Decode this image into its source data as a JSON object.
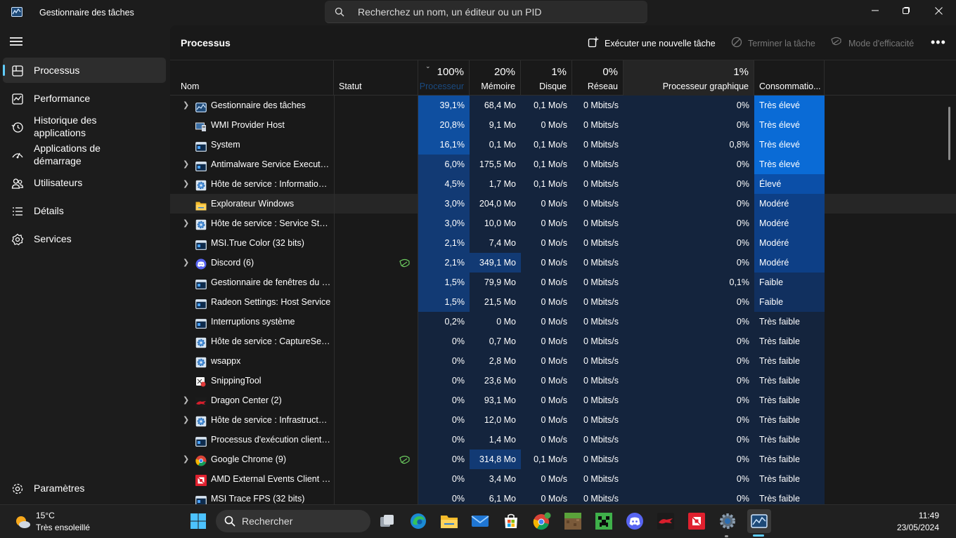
{
  "titlebar": {
    "title": "Gestionnaire des tâches",
    "search_placeholder": "Recherchez un nom, un éditeur ou un PID"
  },
  "sidebar": {
    "items": [
      {
        "label": "Processus",
        "icon": "processes-icon",
        "active": true
      },
      {
        "label": "Performance",
        "icon": "performance-icon"
      },
      {
        "label": "Historique des applications",
        "icon": "history-icon"
      },
      {
        "label": "Applications de démarrage",
        "icon": "startup-icon"
      },
      {
        "label": "Utilisateurs",
        "icon": "users-icon"
      },
      {
        "label": "Détails",
        "icon": "details-icon"
      },
      {
        "label": "Services",
        "icon": "services-icon"
      }
    ],
    "settings_label": "Paramètres"
  },
  "commandbar": {
    "title": "Processus",
    "run_task": "Exécuter une nouvelle tâche",
    "end_task": "Terminer la tâche",
    "efficiency": "Mode d'efficacité"
  },
  "table": {
    "headers": {
      "name": "Nom",
      "status": "Statut",
      "cpu_pct": "100%",
      "cpu": "Processeur",
      "mem_pct": "20%",
      "mem": "Mémoire",
      "disk_pct": "1%",
      "disk": "Disque",
      "net_pct": "0%",
      "net": "Réseau",
      "gpu_pct": "1%",
      "gpu": "Processeur graphique",
      "power": "Consommatio..."
    },
    "rows": [
      {
        "name": "Gestionnaire des tâches",
        "expand": true,
        "icon": "taskmgr",
        "cpu": "39,1%",
        "mem": "68,4 Mo",
        "disk": "0,1 Mo/s",
        "net": "0 Mbits/s",
        "gpu": "0%",
        "power": "Très élevé",
        "cpu_level": 3,
        "mem_level": 1,
        "power_level": 4
      },
      {
        "name": "WMI Provider Host",
        "expand": false,
        "icon": "wmi",
        "cpu": "20,8%",
        "mem": "9,1 Mo",
        "disk": "0 Mo/s",
        "net": "0 Mbits/s",
        "gpu": "0%",
        "power": "Très élevé",
        "cpu_level": 3,
        "mem_level": 1,
        "power_level": 4
      },
      {
        "name": "System",
        "expand": false,
        "icon": "window",
        "cpu": "16,1%",
        "mem": "0,1 Mo",
        "disk": "0,1 Mo/s",
        "net": "0 Mbits/s",
        "gpu": "0,8%",
        "power": "Très élevé",
        "cpu_level": 3,
        "mem_level": 1,
        "power_level": 4
      },
      {
        "name": "Antimalware Service Executable",
        "expand": true,
        "icon": "window",
        "cpu": "6,0%",
        "mem": "175,5 Mo",
        "disk": "0,1 Mo/s",
        "net": "0 Mbits/s",
        "gpu": "0%",
        "power": "Très élevé",
        "cpu_level": 2,
        "mem_level": 1,
        "power_level": 4
      },
      {
        "name": "Hôte de service : Informations...",
        "expand": true,
        "icon": "gear",
        "cpu": "4,5%",
        "mem": "1,7 Mo",
        "disk": "0,1 Mo/s",
        "net": "0 Mbits/s",
        "gpu": "0%",
        "power": "Élevé",
        "cpu_level": 2,
        "mem_level": 1,
        "power_level": 3
      },
      {
        "name": "Explorateur Windows",
        "expand": false,
        "icon": "folder",
        "cpu": "3,0%",
        "mem": "204,0 Mo",
        "disk": "0 Mo/s",
        "net": "0 Mbits/s",
        "gpu": "0%",
        "power": "Modéré",
        "cpu_level": 2,
        "mem_level": 1,
        "power_level": 2,
        "hover": true
      },
      {
        "name": "Hôte de service : Service State ...",
        "expand": true,
        "icon": "gear",
        "cpu": "3,0%",
        "mem": "10,0 Mo",
        "disk": "0 Mo/s",
        "net": "0 Mbits/s",
        "gpu": "0%",
        "power": "Modéré",
        "cpu_level": 2,
        "mem_level": 1,
        "power_level": 2
      },
      {
        "name": "MSI.True Color (32 bits)",
        "expand": false,
        "icon": "window",
        "cpu": "2,1%",
        "mem": "7,4 Mo",
        "disk": "0 Mo/s",
        "net": "0 Mbits/s",
        "gpu": "0%",
        "power": "Modéré",
        "cpu_level": 2,
        "mem_level": 1,
        "power_level": 2
      },
      {
        "name": "Discord (6)",
        "expand": true,
        "icon": "discord",
        "leaf": true,
        "cpu": "2,1%",
        "mem": "349,1 Mo",
        "disk": "0 Mo/s",
        "net": "0 Mbits/s",
        "gpu": "0%",
        "power": "Modéré",
        "cpu_level": 2,
        "mem_level": 2,
        "power_level": 2
      },
      {
        "name": "Gestionnaire de fenêtres du B...",
        "expand": false,
        "icon": "window",
        "cpu": "1,5%",
        "mem": "79,9 Mo",
        "disk": "0 Mo/s",
        "net": "0 Mbits/s",
        "gpu": "0,1%",
        "power": "Faible",
        "cpu_level": 2,
        "mem_level": 1,
        "power_level": 1
      },
      {
        "name": "Radeon Settings: Host Service",
        "expand": false,
        "icon": "window",
        "cpu": "1,5%",
        "mem": "21,5 Mo",
        "disk": "0 Mo/s",
        "net": "0 Mbits/s",
        "gpu": "0%",
        "power": "Faible",
        "cpu_level": 2,
        "mem_level": 1,
        "power_level": 1
      },
      {
        "name": "Interruptions système",
        "expand": false,
        "icon": "window",
        "cpu": "0,2%",
        "mem": "0 Mo",
        "disk": "0 Mo/s",
        "net": "0 Mbits/s",
        "gpu": "0%",
        "power": "Très faible",
        "cpu_level": 1,
        "mem_level": 1,
        "power_level": 0
      },
      {
        "name": "Hôte de service : CaptureServi...",
        "expand": false,
        "icon": "gear",
        "cpu": "0%",
        "mem": "0,7 Mo",
        "disk": "0 Mo/s",
        "net": "0 Mbits/s",
        "gpu": "0%",
        "power": "Très faible",
        "cpu_level": 1,
        "mem_level": 1,
        "power_level": 0
      },
      {
        "name": "wsappx",
        "expand": false,
        "icon": "gear",
        "cpu": "0%",
        "mem": "2,8 Mo",
        "disk": "0 Mo/s",
        "net": "0 Mbits/s",
        "gpu": "0%",
        "power": "Très faible",
        "cpu_level": 1,
        "mem_level": 1,
        "power_level": 0
      },
      {
        "name": "SnippingTool",
        "expand": false,
        "icon": "snip",
        "cpu": "0%",
        "mem": "23,6 Mo",
        "disk": "0 Mo/s",
        "net": "0 Mbits/s",
        "gpu": "0%",
        "power": "Très faible",
        "cpu_level": 1,
        "mem_level": 1,
        "power_level": 0
      },
      {
        "name": "Dragon Center (2)",
        "expand": true,
        "icon": "dragon",
        "cpu": "0%",
        "mem": "93,1 Mo",
        "disk": "0 Mo/s",
        "net": "0 Mbits/s",
        "gpu": "0%",
        "power": "Très faible",
        "cpu_level": 1,
        "mem_level": 1,
        "power_level": 0
      },
      {
        "name": "Hôte de service : Infrastructur...",
        "expand": true,
        "icon": "gear",
        "cpu": "0%",
        "mem": "12,0 Mo",
        "disk": "0 Mo/s",
        "net": "0 Mbits/s",
        "gpu": "0%",
        "power": "Très faible",
        "cpu_level": 1,
        "mem_level": 1,
        "power_level": 0
      },
      {
        "name": "Processus d'exécution client-s...",
        "expand": false,
        "icon": "window",
        "cpu": "0%",
        "mem": "1,4 Mo",
        "disk": "0 Mo/s",
        "net": "0 Mbits/s",
        "gpu": "0%",
        "power": "Très faible",
        "cpu_level": 1,
        "mem_level": 1,
        "power_level": 0
      },
      {
        "name": "Google Chrome (9)",
        "expand": true,
        "icon": "chrome",
        "leaf": true,
        "cpu": "0%",
        "mem": "314,8 Mo",
        "disk": "0,1 Mo/s",
        "net": "0 Mbits/s",
        "gpu": "0%",
        "power": "Très faible",
        "cpu_level": 1,
        "mem_level": 2,
        "power_level": 0
      },
      {
        "name": "AMD External Events Client M...",
        "expand": false,
        "icon": "amd",
        "cpu": "0%",
        "mem": "3,4 Mo",
        "disk": "0 Mo/s",
        "net": "0 Mbits/s",
        "gpu": "0%",
        "power": "Très faible",
        "cpu_level": 1,
        "mem_level": 1,
        "power_level": 0
      },
      {
        "name": "MSI Trace FPS (32 bits)",
        "expand": false,
        "icon": "window",
        "cpu": "0%",
        "mem": "6,1 Mo",
        "disk": "0 Mo/s",
        "net": "0 Mbits/s",
        "gpu": "0%",
        "power": "Très faible",
        "cpu_level": 1,
        "mem_level": 1,
        "power_level": 0
      }
    ]
  },
  "taskbar": {
    "temperature": "15°C",
    "weather": "Très ensoleillé",
    "search_label": "Rechercher",
    "time": "11:49",
    "date": "23/05/2024",
    "apps": [
      "task-view",
      "edge",
      "file-explorer",
      "mail",
      "store",
      "chrome",
      "minecraft",
      "creeper",
      "discord",
      "dragon-center",
      "amd",
      "settings",
      "task-manager"
    ]
  },
  "colors": {
    "cpu_high": "#0f4fa0",
    "cpu_mid": "#123a74",
    "base_cell": "#14243d",
    "power_very_high": "#0a6bd6",
    "power_high": "#0b4fa8",
    "power_mod": "#0d3f86",
    "power_low": "#11305f",
    "power_vlow": "#14243d"
  }
}
